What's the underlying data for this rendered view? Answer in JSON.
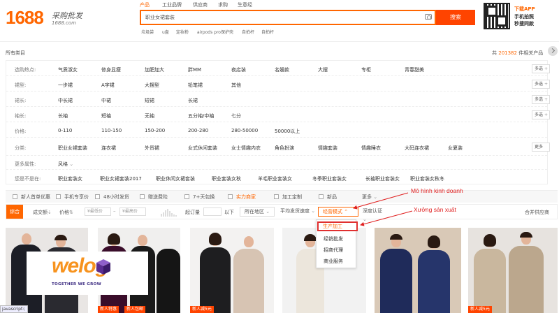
{
  "header": {
    "logo_number": "1688",
    "logo_chinese": "采购批发",
    "logo_url": "1688.com",
    "search_tabs": [
      "产品",
      "工业品牌",
      "供应商",
      "求购",
      "生意经"
    ],
    "search_value": "职业女裙套装",
    "search_button": "搜索",
    "hot_words": [
      "垃圾袋",
      "u盘",
      "定妆粉",
      "airpods pro保护壳",
      "自拍杆",
      "自拍杆"
    ],
    "app_promo": [
      "下载APP",
      "手机拍照",
      "秒搜同款"
    ]
  },
  "category_bar": {
    "all_categories": "所有类目",
    "result_prefix": "共",
    "result_count": "201382",
    "result_suffix": "件相关产品"
  },
  "filters": [
    {
      "label": "选购热点:",
      "options": [
        "气质淑女",
        "修身显瘦",
        "加肥加大",
        "胖MM",
        "夜店装",
        "名媛款",
        "大摆",
        "专柜",
        "青春甜美"
      ],
      "action": "多选"
    },
    {
      "label": "裙型:",
      "options": [
        "一步裙",
        "A字裙",
        "大摆型",
        "铅笔裙",
        "其他"
      ],
      "action": "多选"
    },
    {
      "label": "裙长:",
      "options": [
        "中长裙",
        "中裙",
        "短裙",
        "长裙"
      ],
      "action": "多选"
    },
    {
      "label": "袖长:",
      "options": [
        "长袖",
        "短袖",
        "无袖",
        "五分袖/中袖",
        "七分"
      ],
      "action": "多选"
    },
    {
      "label": "价格:",
      "options": [
        "0-110",
        "110-150",
        "150-200",
        "200-280",
        "280-50000",
        "50000以上"
      ],
      "action": ""
    },
    {
      "label": "分类:",
      "options": [
        "职业女裙套装",
        "连衣裙",
        "外贸裙",
        "女式休闲套装",
        "女士情趣内衣",
        "角色扮演",
        "情趣套装",
        "情趣睡衣",
        "大码连衣裙",
        "女夏装"
      ],
      "action": "更多"
    },
    {
      "label": "更多属性:",
      "options": [
        "风格"
      ],
      "action": ""
    },
    {
      "label": "您是不是在:",
      "options": [
        "职业套装女",
        "职业女裙套装2017",
        "职业休闲女裙套装",
        "职业套装女秋",
        "羊毛职业套装女",
        "冬季职业套装女",
        "长袖职业套装女",
        "职业套装女秋冬"
      ],
      "action": ""
    }
  ],
  "quick_filters": [
    "新人首单优惠",
    "手机专享价",
    "48小时发货",
    "赠送费险",
    "7+天包换",
    "实力商家",
    "加工定制",
    "新品",
    "更多"
  ],
  "sort_bar": {
    "default": "综合",
    "volume": "成交额",
    "price": "价格",
    "min_price": "¥最低价",
    "max_price": "¥最高价",
    "min_order_label": "起订量",
    "min_order_suffix": "以下",
    "location": "所在地区",
    "ship_speed": "平均发货速度",
    "business_mode": "经营模式",
    "depth_cert": "深度认证",
    "merge_suppliers": "合并供应商"
  },
  "business_dropdown": [
    "生产加工",
    "经销批发",
    "招商代理",
    "商业服务"
  ],
  "annotations": {
    "business_model": "Mô hình kinh doanh",
    "manufacturing": "Xưởng sản xuất"
  },
  "product_tags": [
    "新人特惠",
    "新人包邮",
    "新人减5元",
    "",
    "",
    "新人减5元"
  ],
  "watermark": {
    "brand": "welog",
    "tagline": "TOGETHER WE GROW"
  },
  "status_bar": "javascript:;",
  "colors": {
    "accent": "#ff6600",
    "search_button": "#ff4400",
    "annotation": "#e02020"
  }
}
